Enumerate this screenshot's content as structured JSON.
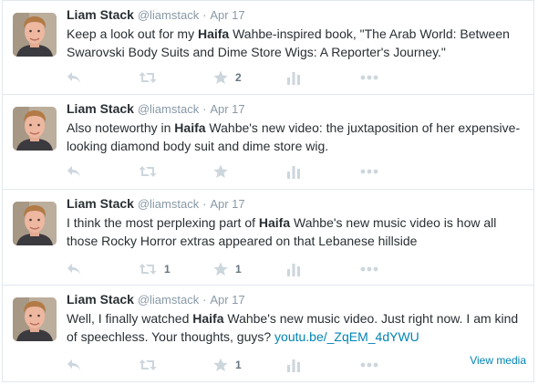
{
  "tweets": [
    {
      "fullname": "Liam Stack",
      "username": "@liamstack",
      "separator": "·",
      "time": "Apr 17",
      "text_segments": [
        {
          "t": "Keep a look out for my ",
          "style": "plain"
        },
        {
          "t": "Haifa",
          "style": "bold"
        },
        {
          "t": " Wahbe-inspired book, \"The Arab World: Between Swarovski Body Suits and Dime Store Wigs: A Reporter's Journey.\"",
          "style": "plain"
        }
      ],
      "retweet_count": "",
      "favorite_count": "2",
      "view_media": ""
    },
    {
      "fullname": "Liam Stack",
      "username": "@liamstack",
      "separator": "·",
      "time": "Apr 17",
      "text_segments": [
        {
          "t": "Also noteworthy in ",
          "style": "plain"
        },
        {
          "t": "Haifa",
          "style": "bold"
        },
        {
          "t": " Wahbe's new video: the juxtaposition of her expensive-looking diamond body suit and dime store wig.",
          "style": "plain"
        }
      ],
      "retweet_count": "",
      "favorite_count": "",
      "view_media": ""
    },
    {
      "fullname": "Liam Stack",
      "username": "@liamstack",
      "separator": "·",
      "time": "Apr 17",
      "text_segments": [
        {
          "t": "I think the most perplexing part of ",
          "style": "plain"
        },
        {
          "t": "Haifa",
          "style": "bold"
        },
        {
          "t": " Wahbe's new music video is how all those Rocky Horror extras appeared on that Lebanese hillside",
          "style": "plain"
        }
      ],
      "retweet_count": "1",
      "favorite_count": "1",
      "view_media": ""
    },
    {
      "fullname": "Liam Stack",
      "username": "@liamstack",
      "separator": "·",
      "time": "Apr 17",
      "text_segments": [
        {
          "t": "Well, I finally watched ",
          "style": "plain"
        },
        {
          "t": "Haifa",
          "style": "bold"
        },
        {
          "t": " Wahbe's new music video. Just right now. I am kind of speechless. Your thoughts, guys? ",
          "style": "plain"
        },
        {
          "t": "youtu.be/_ZqEM_4dYWU",
          "style": "link"
        }
      ],
      "retweet_count": "",
      "favorite_count": "1",
      "view_media": "View media"
    }
  ],
  "icons": {
    "reply": "reply-icon",
    "retweet": "retweet-icon",
    "favorite": "star-icon",
    "stats": "stats-icon",
    "more": "more-icon"
  },
  "colors": {
    "link": "#0084b4",
    "muted": "#8899a6",
    "icon": "#ccd6dd",
    "border": "#e1e8ed"
  }
}
